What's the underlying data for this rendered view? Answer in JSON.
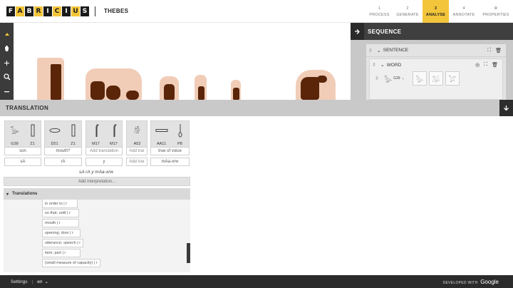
{
  "header": {
    "logo_letters": [
      "F",
      "A",
      "B",
      "R",
      "I",
      "C",
      "I",
      "U",
      "S"
    ],
    "project_name": "THEBES",
    "steps": [
      {
        "num": "1",
        "label": "PROCESS"
      },
      {
        "num": "2",
        "label": "GENERATE"
      },
      {
        "num": "3",
        "label": "ANALYSE"
      },
      {
        "num": "4",
        "label": "ANNOTATE"
      },
      {
        "num": "⚙",
        "label": "PROPERTIES"
      }
    ],
    "active_step": "ANALYSE",
    "accent_color": "#f3c53a"
  },
  "toolbar": {
    "icons": [
      "chevron-up-icon",
      "hand-icon",
      "plus-icon",
      "search-icon",
      "minus-icon"
    ]
  },
  "sequence": {
    "title": "SEQUENCE",
    "sentence_label": "SENTENCE",
    "word_label": "WORD",
    "glyph_code": "G39"
  },
  "translation": {
    "title": "TRANSLATION",
    "glyph_groups": [
      {
        "codes": [
          "G39",
          "Z1"
        ]
      },
      {
        "codes": [
          "D21",
          "Z1"
        ]
      },
      {
        "codes": [
          "M17",
          "M17"
        ]
      },
      {
        "codes": [
          "A52"
        ]
      },
      {
        "codes": [
          "AA11",
          "P8"
        ]
      }
    ],
    "meanings": [
      "son",
      "mouth?",
      "Add translation",
      "Add trar",
      "true of voice"
    ],
    "transliterations": [
      "sA",
      "rA",
      "y",
      "Add trar",
      "mAa-xrw"
    ],
    "full_transliteration": "sA rA y mAa-xrw",
    "add_interpretation": "Add interpretation...",
    "translations_header": "Translations",
    "translation_options": [
      "in order to | r",
      "so that; until | r",
      "mouth | r",
      "opening; door | r",
      "utterance; speech | r",
      "item; part | r",
      "(small measure of capacity) | r"
    ]
  },
  "footer": {
    "settings": "Settings",
    "separator": "|",
    "language": "en",
    "developed_with": "DEVELOPED WITH",
    "brand": "Google"
  }
}
